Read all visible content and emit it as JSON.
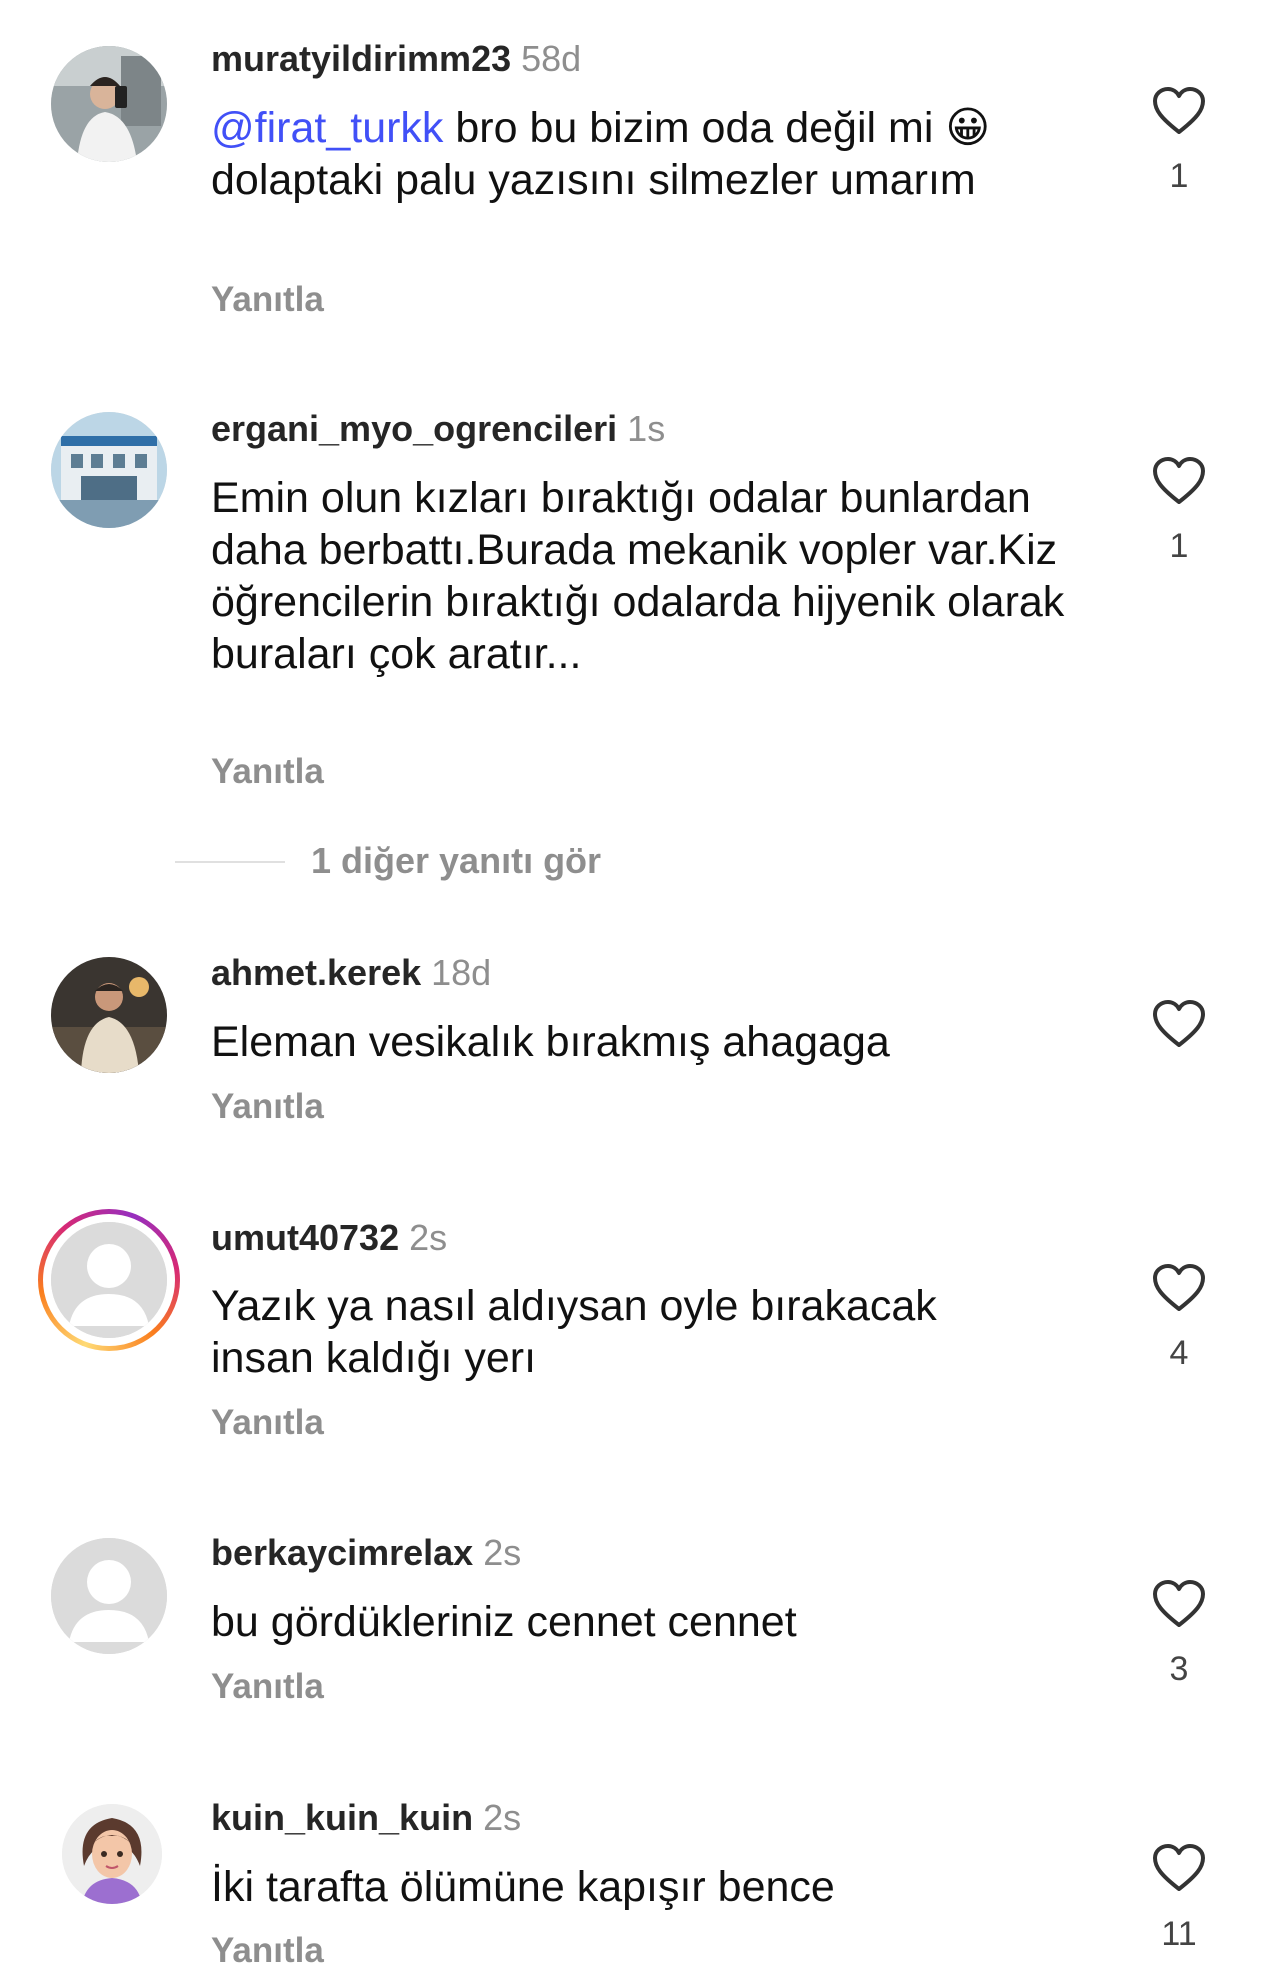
{
  "comments": [
    {
      "username": "muratyildirimm23",
      "time": "58d",
      "mention": "@firat_turkk",
      "text_after_mention": " bro bu bizim oda değil mi 😀 dolaptaki palu yazısını silmezler umarım",
      "reply_label": "Yanıtla",
      "likes": "1",
      "avatar": "photo-man-mirror-selfie"
    },
    {
      "username": "ergani_myo_ogrencileri",
      "time": "1s",
      "text": "Emin olun kızları bıraktığı odalar bunlardan daha berbattı.Burada mekanik vopler var.Kiz öğrencilerin bıraktığı odalarda hijyenik olarak  buraları çok aratır...",
      "reply_label": "Yanıtla",
      "likes": "1",
      "avatar": "photo-building"
    },
    {
      "username": "ahmet.kerek",
      "time": "18d",
      "text": "Eleman vesikalık bırakmış ahagaga",
      "reply_label": "Yanıtla",
      "likes": "",
      "avatar": "photo-man-sitting"
    },
    {
      "username": "umut40732",
      "time": "2s",
      "text": "Yazık ya nasıl aldıysan  oyle bırakacak insan kaldığı  yerı",
      "reply_label": "Yanıtla",
      "likes": "4",
      "avatar": "default-avatar-with-story-ring"
    },
    {
      "username": "berkaycimrelax",
      "time": "2s",
      "text": "bu gördükleriniz cennet cennet",
      "reply_label": "Yanıtla",
      "likes": "3",
      "avatar": "default-avatar"
    },
    {
      "username": "kuin_kuin_kuin",
      "time": "2s",
      "text": "İki tarafta ölümüne kapışır bence",
      "reply_label": "Yanıtla",
      "likes": "11",
      "avatar": "cartoon-woman-avatar"
    }
  ],
  "view_more_replies": "1 diğer yanıtı gör",
  "colors": {
    "mention": "#4150f7",
    "secondary_text": "#8e8e8e",
    "username": "#262626"
  },
  "icons": {
    "like": "heart-outline-icon"
  }
}
